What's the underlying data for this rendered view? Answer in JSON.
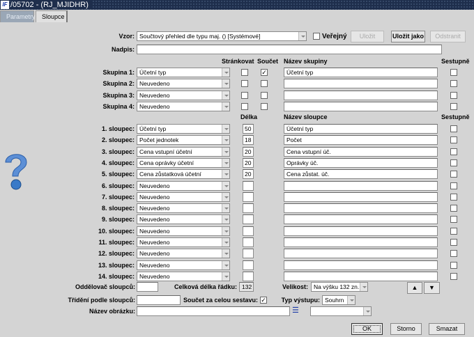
{
  "window": {
    "title": "/05702 - (RJ_MJIDHR)",
    "logo": "IF"
  },
  "tabs": [
    {
      "label": "Parametry"
    },
    {
      "label": "Sloupce"
    }
  ],
  "vzor": {
    "label": "Vzor:",
    "value": "Součtový přehled dle typu maj.   ()   [Systémové]",
    "public_label": "Veřejný",
    "public_checked": false
  },
  "buttons": {
    "save": "Uložit",
    "save_as": "Uložit jako",
    "remove": "Odstranit",
    "ok": "OK",
    "cancel": "Storno",
    "clear": "Smazat"
  },
  "nadpis": {
    "label": "Nadpis:",
    "value": ""
  },
  "group_headers": {
    "paging": "Stránkovat",
    "sum": "Součet",
    "name": "Název skupiny",
    "desc": "Sestupně"
  },
  "groups": [
    {
      "label": "Skupina 1:",
      "value": "Účetní typ",
      "paging": false,
      "sum": true,
      "name": "Účetní typ",
      "desc": false
    },
    {
      "label": "Skupina 2:",
      "value": "Neuvedeno",
      "paging": false,
      "sum": false,
      "name": "",
      "desc": false
    },
    {
      "label": "Skupina 3:",
      "value": "Neuvedeno",
      "paging": false,
      "sum": false,
      "name": "",
      "desc": false
    },
    {
      "label": "Skupina 4:",
      "value": "Neuvedeno",
      "paging": false,
      "sum": false,
      "name": "",
      "desc": false
    }
  ],
  "column_headers": {
    "length": "Délka",
    "name": "Název sloupce",
    "desc": "Sestupně"
  },
  "columns": [
    {
      "label": "1. sloupec:",
      "value": "Účetní typ",
      "length": "50",
      "name": "Účetní typ"
    },
    {
      "label": "2. sloupec:",
      "value": "Počet jednotek",
      "length": "18",
      "name": "Počet"
    },
    {
      "label": "3. sloupec:",
      "value": "Cena vstupní účetní",
      "length": "20",
      "name": "Cena vstupní úč."
    },
    {
      "label": "4. sloupec:",
      "value": "Cena oprávky účetní",
      "length": "20",
      "name": "Oprávky úč."
    },
    {
      "label": "5. sloupec:",
      "value": "Cena zůstatková účetní",
      "length": "20",
      "name": "Cena zůstat. úč."
    },
    {
      "label": "6. sloupec:",
      "value": "Neuvedeno",
      "length": "",
      "name": ""
    },
    {
      "label": "7. sloupec:",
      "value": "Neuvedeno",
      "length": "",
      "name": ""
    },
    {
      "label": "8. sloupec:",
      "value": "Neuvedeno",
      "length": "",
      "name": ""
    },
    {
      "label": "9. sloupec:",
      "value": "Neuvedeno",
      "length": "",
      "name": ""
    },
    {
      "label": "10. sloupec:",
      "value": "Neuvedeno",
      "length": "",
      "name": ""
    },
    {
      "label": "11. sloupec:",
      "value": "Neuvedeno",
      "length": "",
      "name": ""
    },
    {
      "label": "12. sloupec:",
      "value": "Neuvedeno",
      "length": "",
      "name": ""
    },
    {
      "label": "13. sloupec:",
      "value": "Neuvedeno",
      "length": "",
      "name": ""
    },
    {
      "label": "14. sloupec:",
      "value": "Neuvedeno",
      "length": "",
      "name": ""
    }
  ],
  "bottom": {
    "separator_label": "Oddělovač sloupců:",
    "separator_value": "",
    "total_length_label": "Celková délka řádku:",
    "total_length_value": "132",
    "size_label": "Velikost:",
    "size_value": "Na výšku 132 zn.",
    "sort_label": "Třídění podle sloupců:",
    "sort_value": "",
    "grand_total_label": "Součet za celou sestavu:",
    "grand_total_checked": true,
    "output_type_label": "Typ výstupu:",
    "output_type_value": "Souhrn",
    "image_label": "Název obrázku:",
    "image_value": "",
    "image_combo_value": ""
  }
}
